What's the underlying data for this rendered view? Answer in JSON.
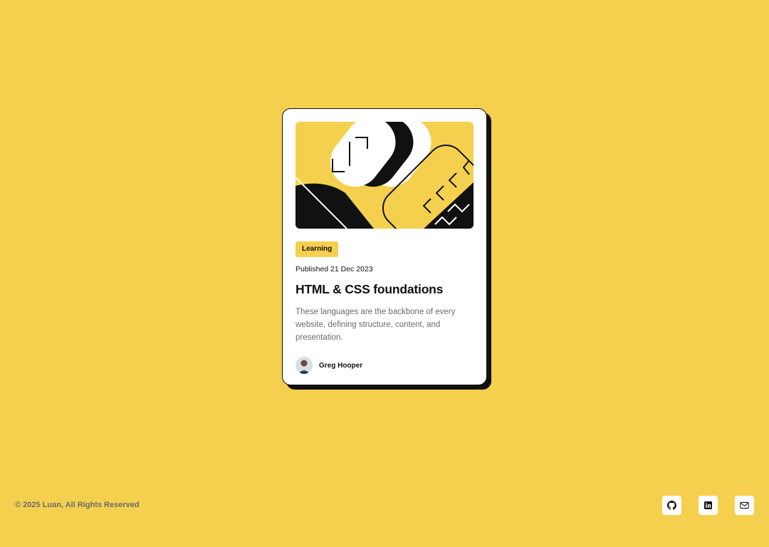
{
  "card": {
    "tag": "Learning",
    "published": "Published 21 Dec 2023",
    "title": "HTML & CSS foundations",
    "description": "These languages are the backbone of every website, defining structure, content, and presentation.",
    "author": "Greg Hooper",
    "hero_icon": "abstract-illustration",
    "avatar_icon": "author-avatar"
  },
  "footer": {
    "copyright": "© 2025 Luan, All Rights Reserved",
    "social": [
      {
        "name": "github-icon"
      },
      {
        "name": "linkedin-icon"
      },
      {
        "name": "mail-icon"
      }
    ]
  },
  "colors": {
    "background": "#f4d04e",
    "card": "#ffffff",
    "ink": "#111111",
    "muted": "#6b6b6b"
  }
}
